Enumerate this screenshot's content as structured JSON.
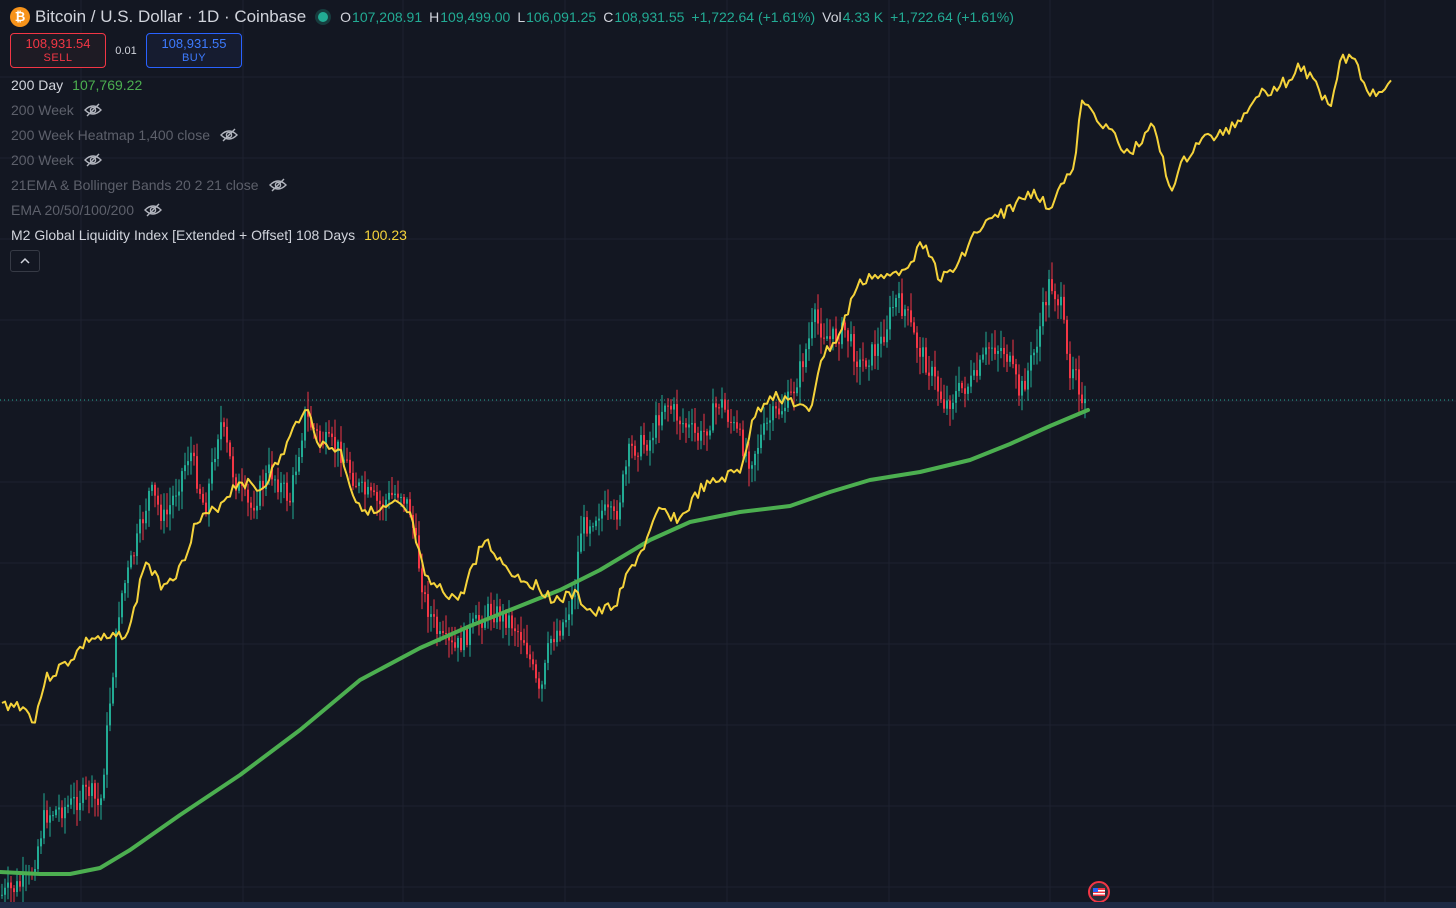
{
  "header": {
    "coin_glyph": "₿",
    "symbol_title": "Bitcoin / U.S. Dollar · 1D · Coinbase",
    "ohlc": [
      {
        "label": "O",
        "value": "107,208.91"
      },
      {
        "label": "H",
        "value": "109,499.00"
      },
      {
        "label": "L",
        "value": "106,091.25"
      },
      {
        "label": "C",
        "value": "108,931.55"
      }
    ],
    "change": "+1,722.64 (+1.61%)",
    "vol_label": "Vol",
    "vol_value": "4.33 K",
    "vol_change": "+1,722.64 (+1.61%)"
  },
  "trade": {
    "sell_price": "108,931.54",
    "sell_label": "SELL",
    "spread": "0.01",
    "buy_price": "108,931.55",
    "buy_label": "BUY"
  },
  "indicators": [
    {
      "name": "200 Day",
      "value": "107,769.22",
      "value_color": "#4caf50",
      "hidden": false
    },
    {
      "name": "200 Week",
      "value": "",
      "hidden": true
    },
    {
      "name": "200 Week Heatmap 1,400 close",
      "value": "",
      "hidden": true
    },
    {
      "name": "200 Week",
      "value": "",
      "hidden": true
    },
    {
      "name": "21EMA & Bollinger Bands 20 2 21 close",
      "value": "",
      "hidden": true
    },
    {
      "name": "EMA 20/50/100/200",
      "value": "",
      "hidden": true
    },
    {
      "name": "M2 Global Liquidity Index [Extended + Offset] 108 Days",
      "value": "100.23",
      "value_color": "#f5d33b",
      "hidden": false
    }
  ],
  "icons": {
    "coin": "bitcoin-icon",
    "live": "market-open-dot",
    "hidden_indicator": "eye-off-icon",
    "collapse": "chevron-up-icon",
    "event": "us-flag-event-icon"
  },
  "colors": {
    "background": "#131722",
    "up": "#22ab94",
    "down": "#f23645",
    "ma200": "#4caf50",
    "m2": "#f5d33b",
    "price_line": "#22ab94"
  }
}
